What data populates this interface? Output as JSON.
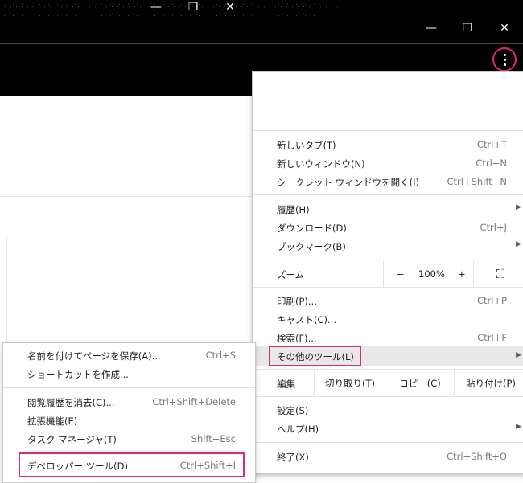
{
  "window": {
    "minimize": "—",
    "restore": "❐",
    "close": "✕"
  },
  "main_menu": {
    "items": [
      {
        "label": "新しいタブ(T)",
        "shortcut": "Ctrl+T"
      },
      {
        "label": "新しいウィンドウ(N)",
        "shortcut": "Ctrl+N"
      },
      {
        "label": "シークレット ウィンドウを開く(I)",
        "shortcut": "Ctrl+Shift+N"
      },
      {
        "label": "履歴(H)",
        "shortcut": ""
      },
      {
        "label": "ダウンロード(D)",
        "shortcut": "Ctrl+J"
      },
      {
        "label": "ブックマーク(B)",
        "shortcut": ""
      },
      {
        "label": "印刷(P)...",
        "shortcut": "Ctrl+P"
      },
      {
        "label": "キャスト(C)...",
        "shortcut": ""
      },
      {
        "label": "検索(F)...",
        "shortcut": "Ctrl+F"
      },
      {
        "label": "その他のツール(L)",
        "shortcut": ""
      },
      {
        "label": "設定(S)",
        "shortcut": ""
      },
      {
        "label": "ヘルプ(H)",
        "shortcut": ""
      },
      {
        "label": "終了(X)",
        "shortcut": "Ctrl+Shift+Q"
      }
    ],
    "zoom": {
      "label": "ズーム",
      "minus": "−",
      "value": "100%",
      "plus": "+",
      "fullscreen": "⛶"
    },
    "edit": {
      "label": "編集",
      "cut": "切り取り(T)",
      "copy": "コピー(C)",
      "paste": "貼り付け(P)"
    }
  },
  "sub_menu": {
    "items": [
      {
        "label": "名前を付けてページを保存(A)...",
        "shortcut": "Ctrl+S"
      },
      {
        "label": "ショートカットを作成...",
        "shortcut": ""
      },
      {
        "label": "閲覧履歴を消去(C)...",
        "shortcut": "Ctrl+Shift+Delete"
      },
      {
        "label": "拡張機能(E)",
        "shortcut": ""
      },
      {
        "label": "タスク マネージャ(T)",
        "shortcut": "Shift+Esc"
      },
      {
        "label": "デベロッパー ツール(D)",
        "shortcut": "Ctrl+Shift+I"
      }
    ]
  }
}
